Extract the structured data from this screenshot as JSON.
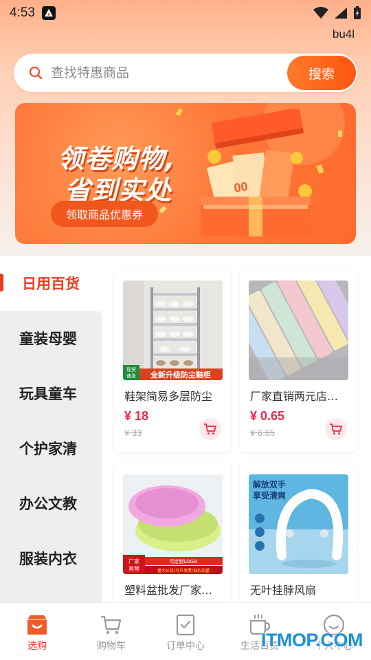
{
  "status_bar": {
    "time": "4:53"
  },
  "user_tag": "bu4l",
  "search": {
    "placeholder": "查找特惠商品",
    "button_label": "搜索"
  },
  "banner": {
    "line1": "领卷购物,",
    "line2": "省到实处",
    "button_label": "领取商品优惠券"
  },
  "sidebar": {
    "items": [
      {
        "label": "日用百货",
        "active": true
      },
      {
        "label": "童装母婴"
      },
      {
        "label": "玩具童车"
      },
      {
        "label": "个护家清"
      },
      {
        "label": "办公文教"
      },
      {
        "label": "服装内衣"
      }
    ]
  },
  "products": [
    {
      "title": "鞋架简易多层防尘",
      "price": "¥ 18",
      "original_price": "¥ 33",
      "image_tag_left": "现货\n速发",
      "image_tag_text": "全新升级防尘鞋柜"
    },
    {
      "title": "厂家直销两元店梳子",
      "price": "¥ 0.65",
      "original_price": "¥ 6.65"
    },
    {
      "title": "塑料盆批发厂家直营",
      "image_tag_left": "厂家\n直营",
      "image_tag_line1": "可定制LOGO",
      "image_tag_line2": "量大从优/可开发票/诚招加盟"
    },
    {
      "title": "无叶挂脖风扇",
      "image_line1": "解放双手",
      "image_line2": "享受清爽"
    }
  ],
  "tabbar": {
    "items": [
      {
        "label": "选购",
        "icon": "shop-icon",
        "active": true
      },
      {
        "label": "购物车",
        "icon": "cart-icon"
      },
      {
        "label": "订单中心",
        "icon": "order-icon"
      },
      {
        "label": "生活百货",
        "icon": "cup-icon"
      },
      {
        "label": "个人中心",
        "icon": "profile-icon"
      }
    ]
  },
  "watermark": "ITMOP.COM",
  "colors": {
    "accent": "#f03a20",
    "price": "#f0254a",
    "search_button": "#ff6418"
  }
}
